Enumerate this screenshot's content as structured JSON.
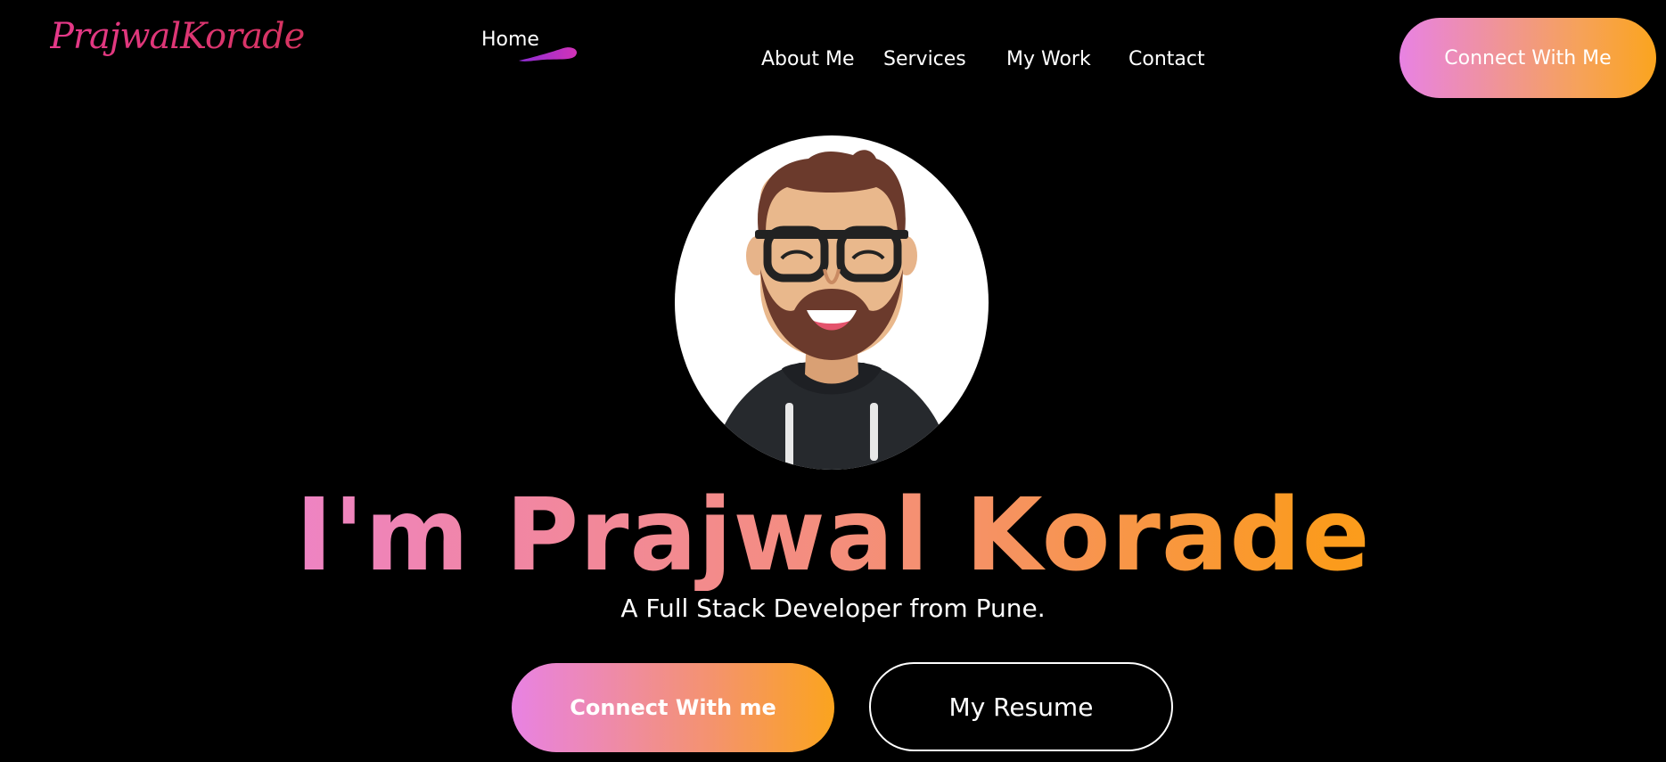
{
  "header": {
    "logo_text": "PrajwalKorade",
    "nav": {
      "home": "Home",
      "about": "About Me",
      "services": "Services",
      "work": "My Work",
      "contact": "Contact"
    },
    "cta_label": "Connect With Me"
  },
  "hero": {
    "title": "I'm Prajwal Korade",
    "subtitle": "A Full Stack Developer from Pune.",
    "primary_button": "Connect With me",
    "secondary_button": "My Resume"
  },
  "colors": {
    "background": "#000000",
    "gradient_start": "#e882e3",
    "gradient_end": "#fba41e",
    "logo": "#e5398a",
    "home_underline": "#c02fb8"
  },
  "icons": {
    "avatar": "avatar-illustration",
    "home_underline": "brush-stroke-icon"
  }
}
